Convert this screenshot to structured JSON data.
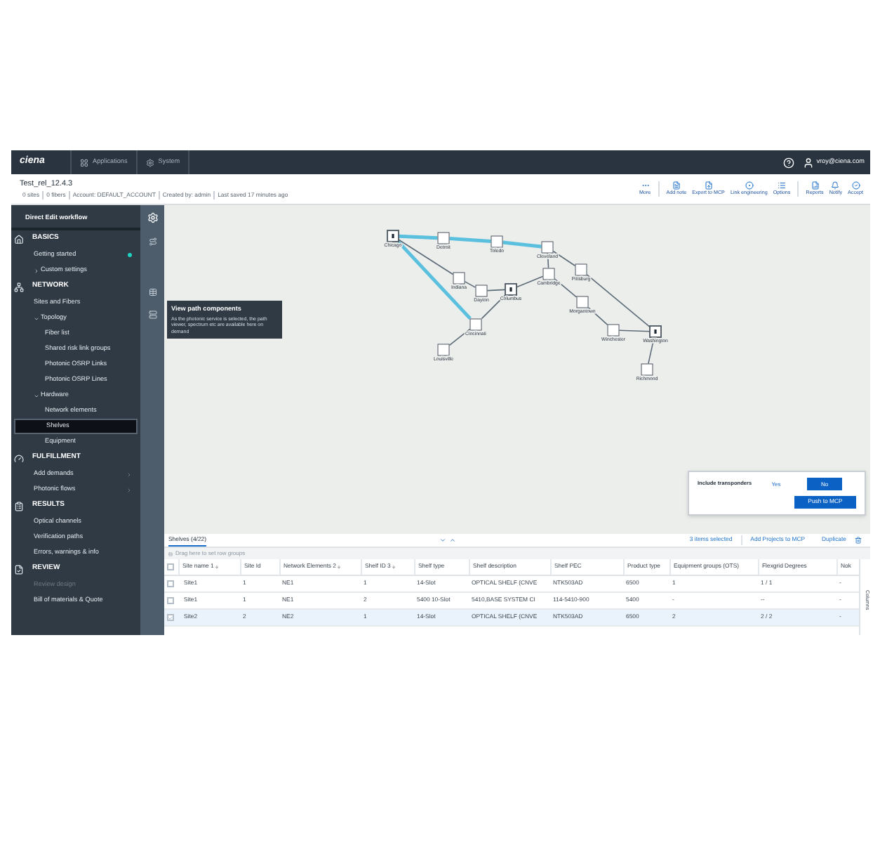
{
  "top_bar": {
    "logo": "ciena",
    "tabs": [
      {
        "label": "Applications",
        "selected": false
      },
      {
        "label": "System",
        "selected": false
      }
    ],
    "user": "vroy@ciena.com"
  },
  "header": {
    "title": "Test_rel_12.4.3",
    "meta": [
      "0 sites",
      "0 fibers",
      "Account: DEFAULT_ACCOUNT",
      "Created by: admin",
      "Last saved 17 minutes ago"
    ],
    "toolbar": [
      {
        "label": "More"
      },
      {
        "label": "Add note"
      },
      {
        "label": "Export to MCP"
      },
      {
        "label": "Link engineering"
      },
      {
        "label": "Options"
      },
      {
        "label": "Reports"
      },
      {
        "label": "Notify"
      },
      {
        "label": "Accept"
      }
    ]
  },
  "sidebar": {
    "workflow_title": "Direct Edit workflow",
    "sections": [
      {
        "title": "BASICS",
        "items": [
          {
            "label": "Getting started",
            "complete": true,
            "selected": false
          },
          {
            "label": "Custom settings",
            "expanded": false,
            "selected": false
          }
        ]
      },
      {
        "title": "NETWORK",
        "items": [
          {
            "label": "Sites and Fibers",
            "selected": false
          },
          {
            "label": "Topology",
            "expanded": true,
            "selected": false,
            "children": [
              {
                "label": "Fiber list",
                "selected": false
              },
              {
                "label": "Shared risk link groups",
                "selected": false
              },
              {
                "label": "Photonic OSRP Links",
                "selected": false
              },
              {
                "label": "Photonic OSRP Lines",
                "selected": false
              }
            ]
          },
          {
            "label": "Hardware",
            "expanded": true,
            "selected": false,
            "children": [
              {
                "label": "Network elements",
                "selected": false
              },
              {
                "label": "Shelves",
                "selected": true
              },
              {
                "label": "Equipment",
                "selected": false
              }
            ]
          }
        ]
      },
      {
        "title": "FULFILLMENT",
        "items": [
          {
            "label": "Add demands",
            "expanded": false,
            "selected": false
          },
          {
            "label": "Photonic flows",
            "expanded": false,
            "selected": false
          }
        ]
      },
      {
        "title": "RESULTS",
        "items": [
          {
            "label": "Optical channels",
            "selected": false
          },
          {
            "label": "Verification paths",
            "selected": false
          },
          {
            "label": "Errors, warnings & info",
            "selected": false
          }
        ]
      },
      {
        "title": "REVIEW",
        "items": [
          {
            "label": "Review design",
            "disabled": true,
            "selected": false
          },
          {
            "label": "Bill of materials & Quote",
            "disabled": false,
            "selected": false
          }
        ]
      }
    ]
  },
  "map": {
    "nodes": [
      {
        "label": "Chicago",
        "kind": "endpoint"
      },
      {
        "label": "Detroit",
        "kind": "site"
      },
      {
        "label": "Toledo",
        "kind": "site"
      },
      {
        "label": "Cleveland",
        "kind": "site"
      },
      {
        "label": "Cambridge",
        "kind": "site"
      },
      {
        "label": "Pittsburg",
        "kind": "site"
      },
      {
        "label": "Indiana",
        "kind": "site"
      },
      {
        "label": "Dayton",
        "kind": "site"
      },
      {
        "label": "Columbus",
        "kind": "endpoint"
      },
      {
        "label": "Morgantown",
        "kind": "site"
      },
      {
        "label": "Cincinnati",
        "kind": "site"
      },
      {
        "label": "Louisville",
        "kind": "site"
      },
      {
        "label": "Winchester",
        "kind": "site"
      },
      {
        "label": "Washington",
        "kind": "endpoint"
      },
      {
        "label": "Richmond",
        "kind": "site"
      }
    ],
    "links": [
      {
        "highlighted": true
      },
      {
        "highlighted": true
      },
      {
        "highlighted": true
      },
      {
        "highlighted": true
      },
      {
        "highlighted": false
      },
      {
        "highlighted": false
      },
      {
        "highlighted": false
      },
      {
        "highlighted": false
      },
      {
        "highlighted": false
      },
      {
        "highlighted": false
      },
      {
        "highlighted": false
      },
      {
        "highlighted": false
      },
      {
        "highlighted": false
      },
      {
        "highlighted": false
      },
      {
        "highlighted": false
      },
      {
        "highlighted": false
      },
      {
        "highlighted": false
      }
    ],
    "tooltip": {
      "title": "View path components",
      "text": "As the photonic service is selected, the path viewer, spectrum etc are available here on demand"
    },
    "popover": {
      "label": "Include transponders",
      "options": [
        {
          "label": "Yes",
          "selected": false
        },
        {
          "label": "No",
          "selected": true
        }
      ],
      "action": "Push to MCP"
    }
  },
  "table": {
    "tab": "Shelves (4/22)",
    "selection": "3 items selected",
    "actions": [
      "Add Projects to MCP",
      "Duplicate"
    ],
    "group_hint": "Drag here to set row groups",
    "side_tab": "Columns",
    "all_checked": false,
    "columns": [
      {
        "label": "Site name 1",
        "sorted": true
      },
      {
        "label": "Site Id",
        "sorted": false
      },
      {
        "label": "Network Elements 2",
        "sorted": true
      },
      {
        "label": "Shelf ID 3",
        "sorted": true
      },
      {
        "label": "Shelf type",
        "sorted": false
      },
      {
        "label": "Shelf description",
        "sorted": false
      },
      {
        "label": "Shelf PEC",
        "sorted": false
      },
      {
        "label": "Product type",
        "sorted": false
      },
      {
        "label": "Equipment groups (OTS)",
        "sorted": false
      },
      {
        "label": "Flexgrid Degrees",
        "sorted": false
      },
      {
        "label": "Nok",
        "sorted": false
      }
    ],
    "rows": [
      {
        "checked": false,
        "cells": [
          "Site1",
          "1",
          "NE1",
          "1",
          "14-Slot",
          "OPTICAL SHELF (CNVE",
          "NTK503AD",
          "6500",
          "1",
          "1 / 1",
          "-"
        ]
      },
      {
        "checked": false,
        "cells": [
          "Site1",
          "1",
          "NE1",
          "2",
          "5400 10-Slot",
          "5410,BASE SYSTEM CI",
          "114-5410-900",
          "5400",
          "-",
          "--",
          "-"
        ]
      },
      {
        "checked": true,
        "cells": [
          "Site2",
          "2",
          "NE2",
          "1",
          "14-Slot",
          "OPTICAL SHELF (CNVE",
          "NTK503AD",
          "6500",
          "2",
          "2 / 2",
          "-"
        ]
      }
    ]
  }
}
